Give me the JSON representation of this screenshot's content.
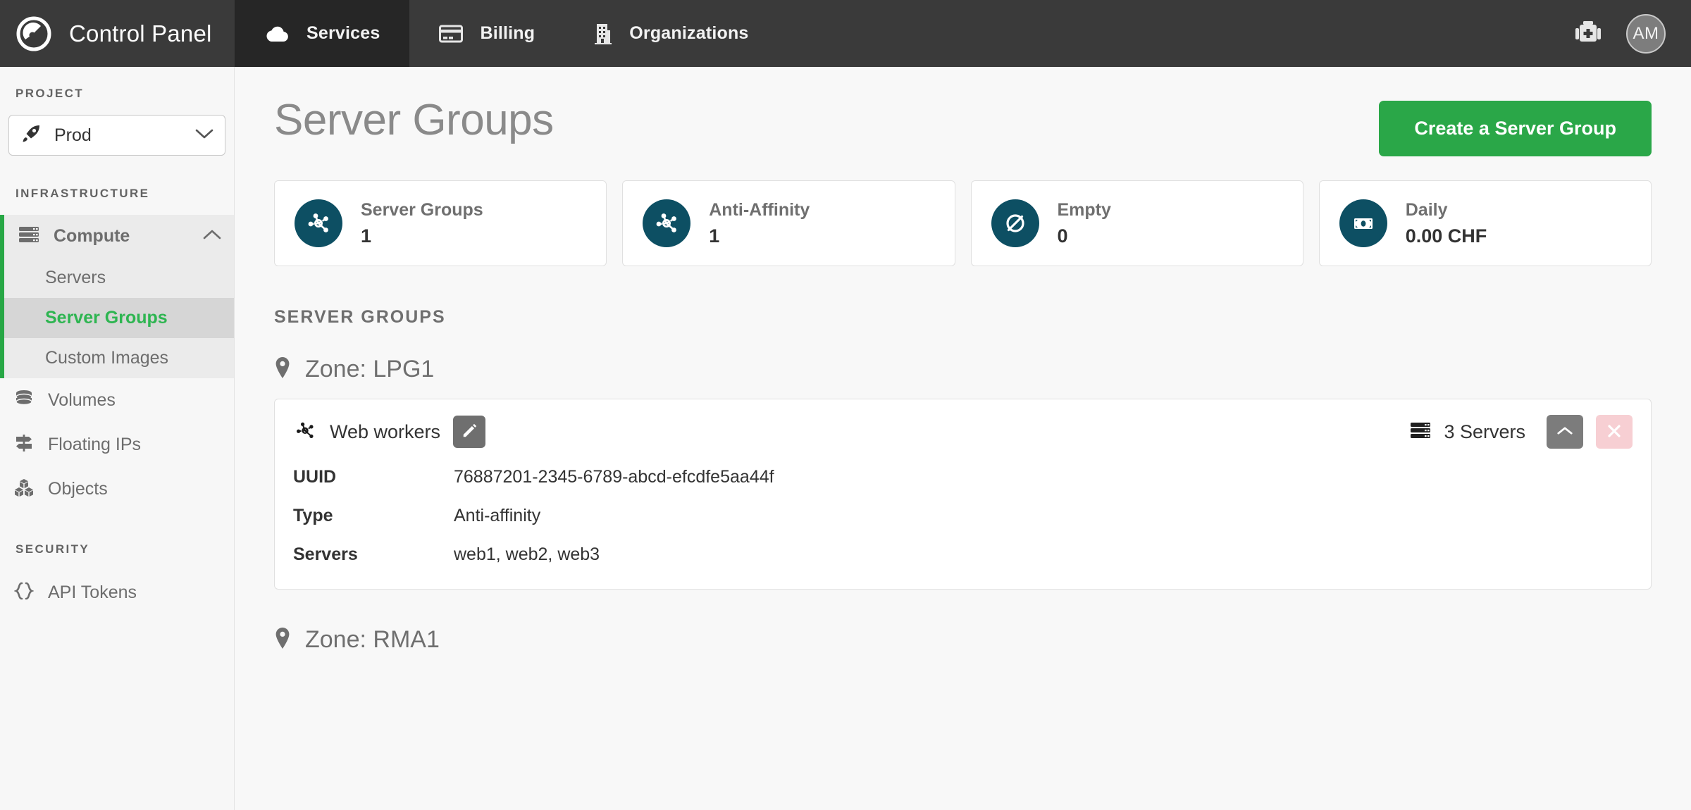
{
  "header": {
    "brand": "Control Panel",
    "brand_logo_icon": "gauge-logo-icon",
    "tabs": [
      {
        "label": "Services",
        "icon": "cloud-icon",
        "active": true
      },
      {
        "label": "Billing",
        "icon": "credit-card-icon",
        "active": false
      },
      {
        "label": "Organizations",
        "icon": "building-icon",
        "active": false
      }
    ],
    "support_icon": "first-aid-kit-icon",
    "avatar_initials": "AM"
  },
  "sidebar": {
    "project_label": "PROJECT",
    "project_value": "Prod",
    "project_icon": "rocket-icon",
    "project_chevron_icon": "chevron-down-icon",
    "infrastructure_label": "INFRASTRUCTURE",
    "compute": {
      "label": "Compute",
      "icon": "server-rack-icon",
      "chevron_icon": "chevron-up-icon",
      "children": [
        {
          "label": "Servers",
          "active": false
        },
        {
          "label": "Server Groups",
          "active": true
        },
        {
          "label": "Custom Images",
          "active": false
        }
      ]
    },
    "items": [
      {
        "label": "Volumes",
        "icon": "database-icon"
      },
      {
        "label": "Floating IPs",
        "icon": "signpost-icon"
      },
      {
        "label": "Objects",
        "icon": "cubes-icon"
      }
    ],
    "security_label": "SECURITY",
    "security_items": [
      {
        "label": "API Tokens",
        "icon": "code-braces-icon"
      }
    ]
  },
  "main": {
    "title": "Server Groups",
    "create_button": "Create a Server Group",
    "stats": [
      {
        "label": "Server Groups",
        "value": "1",
        "icon": "network-nodes-icon"
      },
      {
        "label": "Anti-Affinity",
        "value": "1",
        "icon": "network-nodes-icon"
      },
      {
        "label": "Empty",
        "value": "0",
        "icon": "empty-slash-icon"
      },
      {
        "label": "Daily",
        "value": "0.00 CHF",
        "icon": "banknote-icon"
      }
    ],
    "section_title": "SERVER GROUPS",
    "zones": [
      {
        "name": "Zone: LPG1",
        "pin_icon": "map-pin-icon",
        "groups": [
          {
            "name": "Web workers",
            "group_icon": "network-nodes-icon",
            "edit_icon": "pencil-icon",
            "collapse_icon": "chevron-up-icon",
            "delete_icon": "close-x-icon",
            "servers_count": "3 Servers",
            "servers_icon": "server-rack-icon",
            "fields": [
              {
                "key": "UUID",
                "value": "76887201-2345-6789-abcd-efcdfe5aa44f"
              },
              {
                "key": "Type",
                "value": "Anti-affinity"
              },
              {
                "key": "Servers",
                "value": "web1, web2, web3"
              }
            ]
          }
        ]
      },
      {
        "name": "Zone: RMA1",
        "pin_icon": "map-pin-icon",
        "groups": []
      }
    ]
  },
  "colors": {
    "accent_green": "#2aa748",
    "topbar_dark": "#3a3a3a",
    "tab_active_dark": "#262626",
    "stat_icon_teal": "#0d4f63",
    "delete_pink": "#f7cfd3"
  }
}
